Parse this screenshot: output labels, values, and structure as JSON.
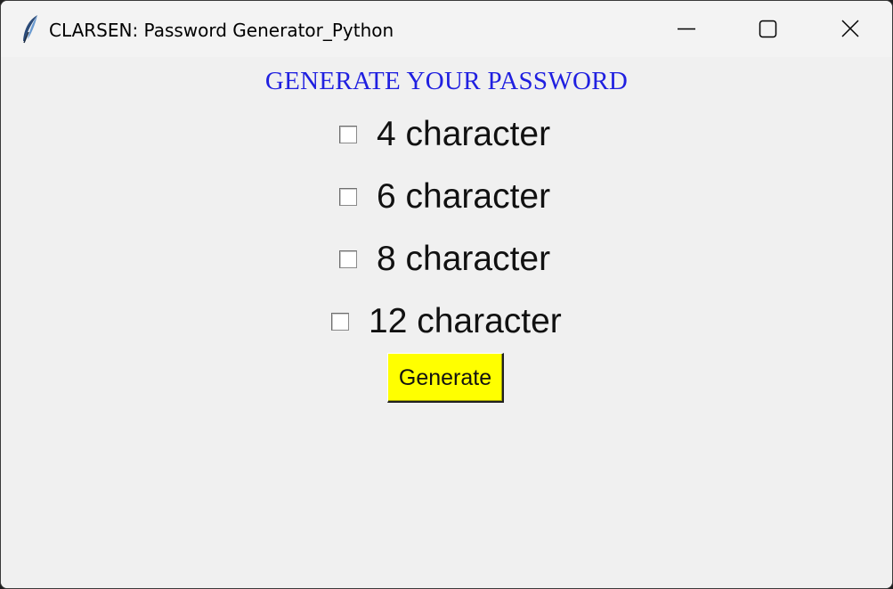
{
  "window": {
    "title": "CLARSEN: Password Generator_Python",
    "icon": "feather-icon",
    "controls": [
      "minimize-icon",
      "maximize-icon",
      "close-icon"
    ]
  },
  "main": {
    "heading": "GENERATE YOUR PASSWORD",
    "heading_color": "#2020e0",
    "options": [
      {
        "label": "4 character",
        "checked": false
      },
      {
        "label": "6 character",
        "checked": false
      },
      {
        "label": "8 character",
        "checked": false
      },
      {
        "label": "12 character",
        "checked": false
      }
    ],
    "generate_label": "Generate",
    "generate_color": "#ffff00"
  }
}
